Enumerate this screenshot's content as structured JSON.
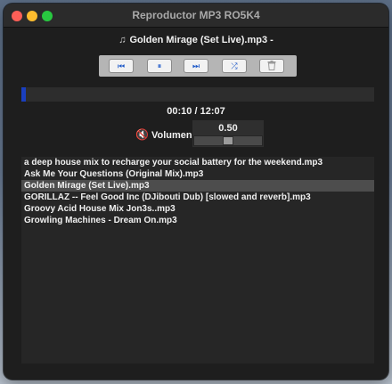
{
  "window": {
    "title": "Reproductor MP3 RO5K4"
  },
  "now_playing": {
    "icon": "music-note-icon",
    "text": "Golden Mirage (Set Live).mp3 -"
  },
  "controls": [
    {
      "name": "previous",
      "icon": "skip-back-icon",
      "glyph": "⏮"
    },
    {
      "name": "pause",
      "icon": "pause-icon",
      "glyph": "⏸"
    },
    {
      "name": "next",
      "icon": "skip-forward-icon",
      "glyph": "⏭"
    },
    {
      "name": "shuffle",
      "icon": "shuffle-icon",
      "glyph": "⤮"
    },
    {
      "name": "delete",
      "icon": "trash-icon",
      "glyph": "🗑"
    }
  ],
  "progress": {
    "fraction": 0.013
  },
  "time": {
    "display": "00:10 / 12:07"
  },
  "volume": {
    "icon": "speaker-muted-icon",
    "label": "Volumen",
    "value_text": "0.50",
    "value": 0.5
  },
  "playlist": {
    "items": [
      "a deep house mix to recharge your social battery for the weekend.mp3",
      "Ask Me Your Questions (Original Mix).mp3",
      "Golden Mirage (Set Live).mp3",
      "GORILLAZ -- Feel Good Inc (DJibouti Dub) [slowed and reverb].mp3",
      "Groovy Acid House Mix Jon3s..mp3",
      "Growling Machines - Dream On.mp3"
    ],
    "selected_index": 2
  },
  "colors": {
    "accent": "#1a3fbf",
    "button_icon": "#1c58c8",
    "close": "#ff5f57",
    "minimize": "#febc2e",
    "maximize": "#28c840"
  }
}
